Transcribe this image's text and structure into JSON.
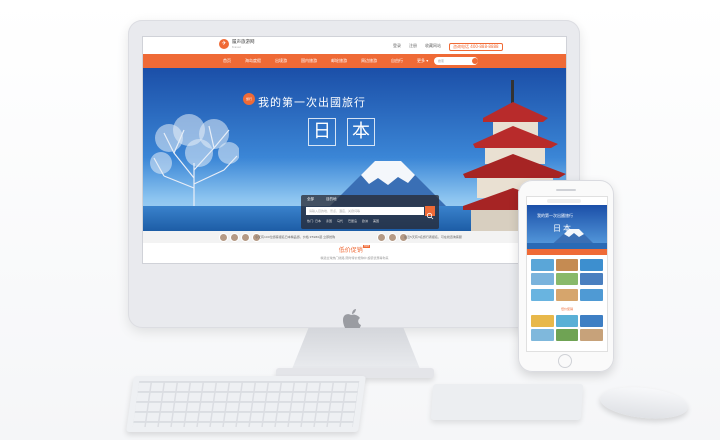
{
  "site": {
    "logo_text": "履声旅游网",
    "logo_sub": "travel",
    "top_links": [
      "登录",
      "注册",
      "收藏网站"
    ],
    "hotline": "咨询电话 400-888-8888",
    "nav": [
      "首页",
      "海岛度假",
      "出境游",
      "国内旅游",
      "邮轮旅游",
      "周边旅游",
      "自由行",
      "更多"
    ],
    "search_placeholder": "搜索"
  },
  "hero": {
    "badge": "旅行",
    "tagline": "我的第一次出國旅行",
    "title_chars": [
      "日",
      "本"
    ],
    "search_tabs": [
      "全部",
      "目的地"
    ],
    "search_placeholder": "请输入目的地、景点、酒店、关键词等",
    "hot_tags": [
      "热门: 日本",
      "泰国",
      "马代",
      "巴厘岛",
      "欧洲",
      "美国"
    ]
  },
  "strip": {
    "text_left": "今天有100位游客报名日本精品游，价格 ¥5980起 立即抢购",
    "text_right": "最近5天有3名旅行者报名，可在线咨询客服"
  },
  "section": {
    "title": "低价促销",
    "badge": "HOT",
    "subtitle": "精选全球热门线路 限时特价抢购中 超值优惠等你来"
  },
  "phone": {
    "tag": "我的第一次出國旅行",
    "title": "日本",
    "section_a": "热门推荐",
    "section_b": "低价促销"
  },
  "colors": {
    "brand_orange": "#ef6a36",
    "sky_blue": "#1b4fa8"
  }
}
